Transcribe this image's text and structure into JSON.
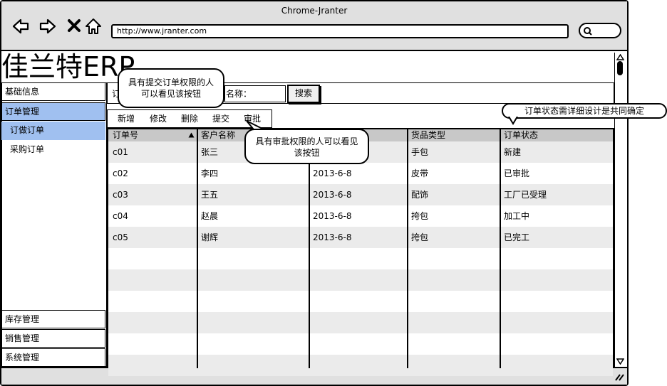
{
  "browser": {
    "title": "Chrome-Jranter",
    "url": "http://www.jranter.com"
  },
  "app": {
    "title": "佳兰特ERP"
  },
  "sidebar": {
    "items": [
      {
        "label": "基础信息"
      },
      {
        "label": "订单管理"
      },
      {
        "label": "订做订单"
      },
      {
        "label": "采购订单"
      },
      {
        "label": "库存管理"
      },
      {
        "label": "销售管理"
      },
      {
        "label": "系统管理"
      }
    ]
  },
  "search": {
    "field1_label": "订",
    "field2_label": "名称：",
    "button": "搜索"
  },
  "toolbar": {
    "buttons": [
      "新增",
      "修改",
      "删除",
      "提交",
      "审批"
    ]
  },
  "grid": {
    "columns": [
      "订单号",
      "客户名称",
      "",
      "货品类型",
      "订单状态"
    ],
    "rows": [
      [
        "c01",
        "张三",
        "",
        "手包",
        "新建"
      ],
      [
        "c02",
        "李四",
        "2013-6-8",
        "皮带",
        "已审批"
      ],
      [
        "c03",
        "王五",
        "2013-6-8",
        "配饰",
        "工厂已受理"
      ],
      [
        "c04",
        "赵晨",
        "2013-6-8",
        "挎包",
        "加工中"
      ],
      [
        "c05",
        "谢辉",
        "2013-6-8",
        "挎包",
        "已完工"
      ]
    ]
  },
  "callouts": {
    "submit_note": "具有提交订单权限的人可以看见该按钮",
    "approve_note": "具有审批权限的人可以看见该按钮",
    "status_note": "订单状态需详细设计是共同确定"
  }
}
